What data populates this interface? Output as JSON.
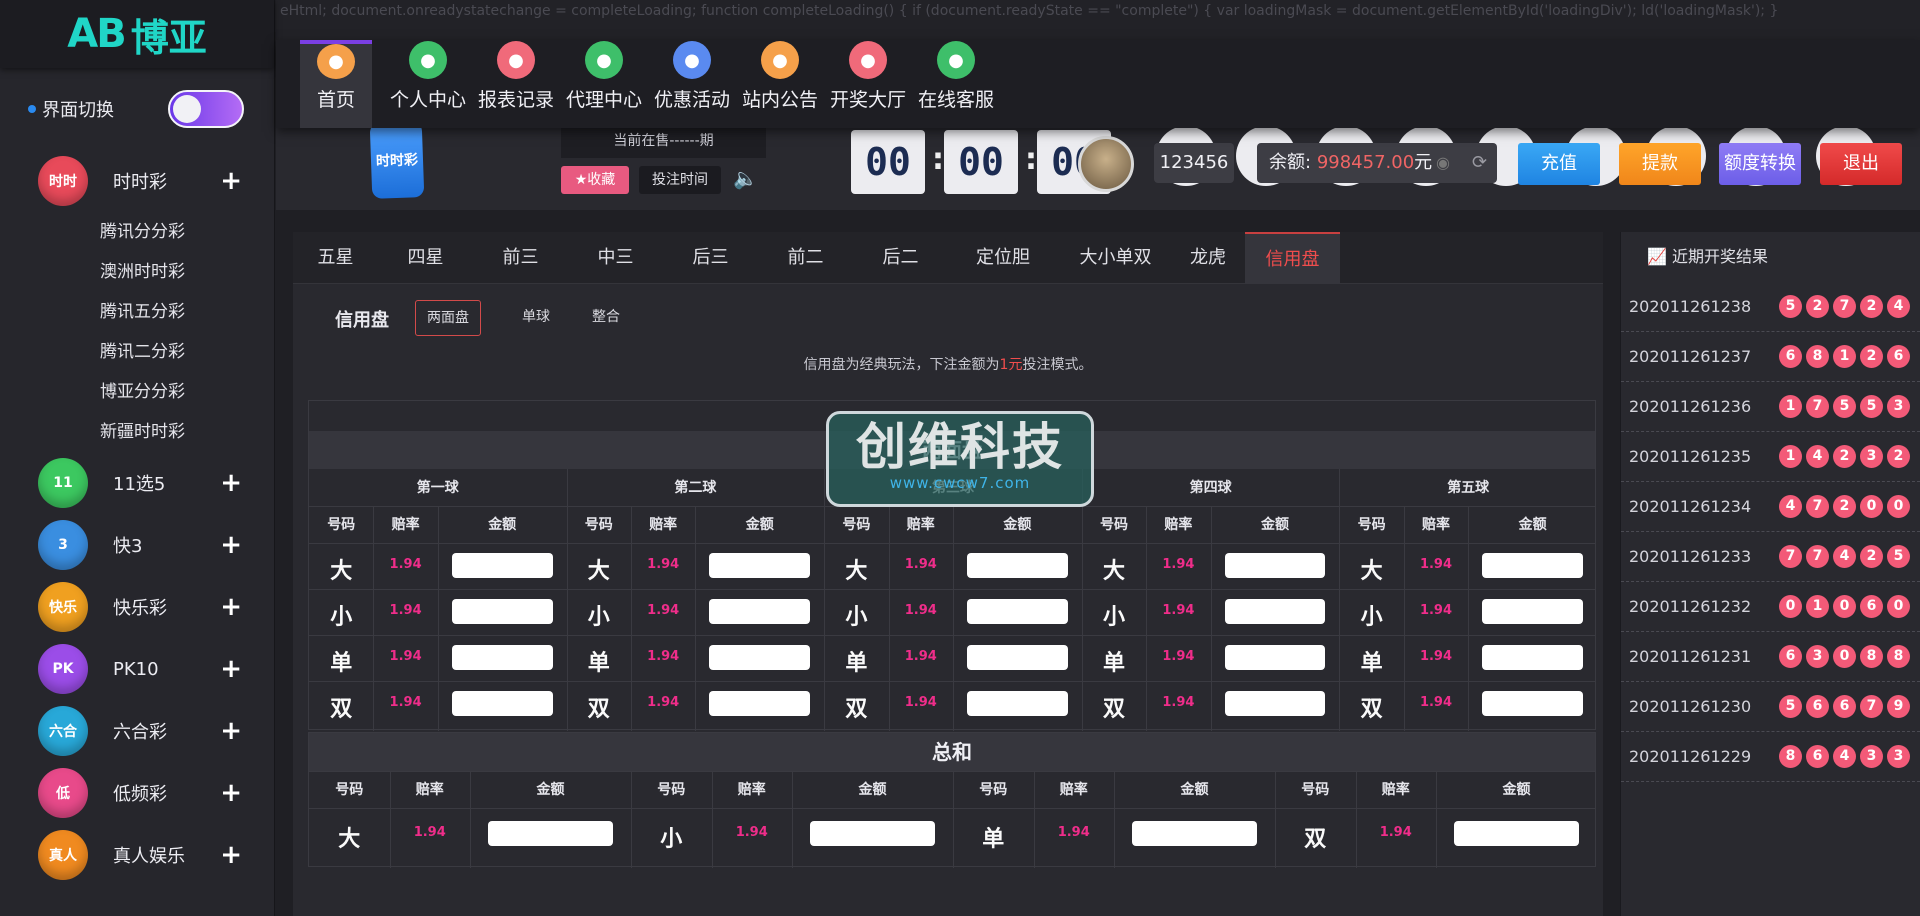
{
  "script_leak": "eHtml; document.onreadystatechange = completeLoading; function completeLoading() { if (document.readyState == \"complete\") { var loadingMask = document.getElementById('loadingDiv'); ld('loadingMask'); }",
  "logo": {
    "mark": "AB",
    "text": "博亚"
  },
  "sidebar": {
    "theme_label": "界面切换",
    "categories": [
      {
        "icon_text": "时时",
        "label": "时时彩",
        "color": "#e84a5a",
        "subs": [
          "腾讯分分彩",
          "澳洲时时彩",
          "腾讯五分彩",
          "腾讯二分彩",
          "博亚分分彩",
          "新疆时时彩"
        ]
      },
      {
        "icon_text": "11",
        "label": "11选5",
        "color": "#3cc860"
      },
      {
        "icon_text": "3",
        "label": "快3",
        "color": "#3a8ee0"
      },
      {
        "icon_text": "快乐",
        "label": "快乐彩",
        "color": "#f0a020"
      },
      {
        "icon_text": "PK",
        "label": "PK10",
        "color": "#9b4de8"
      },
      {
        "icon_text": "六合",
        "label": "六合彩",
        "color": "#28a8d8"
      },
      {
        "icon_text": "低",
        "label": "低频彩",
        "color": "#e84a8a"
      },
      {
        "icon_text": "真人",
        "label": "真人娱乐",
        "color": "#f08a20"
      }
    ],
    "plus": "+"
  },
  "nav": [
    {
      "label": "首页",
      "icon": "home-icon",
      "color": "#f5a04a"
    },
    {
      "label": "个人中心",
      "icon": "user-icon",
      "color": "#3ebf6a"
    },
    {
      "label": "报表记录",
      "icon": "report-icon",
      "color": "#f06a7a"
    },
    {
      "label": "代理中心",
      "icon": "agent-icon",
      "color": "#3ebf6a"
    },
    {
      "label": "优惠活动",
      "icon": "gift-icon",
      "color": "#5a8af0"
    },
    {
      "label": "站内公告",
      "icon": "mail-icon",
      "color": "#f5a04a"
    },
    {
      "label": "开奖大厅",
      "icon": "draw-icon",
      "color": "#f06a7a"
    },
    {
      "label": "在线客服",
      "icon": "support-icon",
      "color": "#3ebf6a"
    }
  ],
  "info": {
    "lottery_logo": "时时彩",
    "sale_text": "当前在售------期",
    "fav_label": "★收藏",
    "time_label": "投注时间",
    "countdown": [
      "00",
      "00",
      "00"
    ],
    "user_id": "123456",
    "balance_prefix": "余额:",
    "balance_value": "998457.00",
    "balance_unit": "元",
    "recharge": "充值",
    "withdraw": "提款",
    "transfer": "额度转换",
    "logout": "退出"
  },
  "tabs": [
    "五星",
    "四星",
    "前三",
    "中三",
    "后三",
    "前二",
    "后二",
    "定位胆",
    "大小单双",
    "龙虎",
    "信用盘"
  ],
  "mode": {
    "label": "信用盘",
    "options": [
      "两面盘",
      "单球",
      "整合"
    ]
  },
  "desc": {
    "before": "信用盘为经典玩法，下注金额为",
    "red": "1元",
    "after": "投注模式。"
  },
  "table1": {
    "title": "两面盘",
    "balls": [
      "第一球",
      "第二球",
      "第三球",
      "第四球",
      "第五球"
    ],
    "headers": [
      "号码",
      "赔率",
      "金额"
    ],
    "rows": [
      {
        "num": "大",
        "odds": "1.94"
      },
      {
        "num": "小",
        "odds": "1.94"
      },
      {
        "num": "单",
        "odds": "1.94"
      },
      {
        "num": "双",
        "odds": "1.94"
      }
    ]
  },
  "table2": {
    "title": "总和",
    "headers": [
      "号码",
      "赔率",
      "金额"
    ],
    "items": [
      {
        "num": "大",
        "odds": "1.94"
      },
      {
        "num": "小",
        "odds": "1.94"
      },
      {
        "num": "单",
        "odds": "1.94"
      },
      {
        "num": "双",
        "odds": "1.94"
      }
    ]
  },
  "watermark": {
    "big": "创维科技",
    "small": "www.cwcw7.com"
  },
  "results": {
    "title": "近期开奖结果",
    "rows": [
      {
        "issue": "202011261238",
        "balls": [
          "5",
          "2",
          "7",
          "2",
          "4"
        ]
      },
      {
        "issue": "202011261237",
        "balls": [
          "6",
          "8",
          "1",
          "2",
          "6"
        ]
      },
      {
        "issue": "202011261236",
        "balls": [
          "1",
          "7",
          "5",
          "5",
          "3"
        ]
      },
      {
        "issue": "202011261235",
        "balls": [
          "1",
          "4",
          "2",
          "3",
          "2"
        ]
      },
      {
        "issue": "202011261234",
        "balls": [
          "4",
          "7",
          "2",
          "0",
          "0"
        ]
      },
      {
        "issue": "202011261233",
        "balls": [
          "7",
          "7",
          "4",
          "2",
          "5"
        ]
      },
      {
        "issue": "202011261232",
        "balls": [
          "0",
          "1",
          "0",
          "6",
          "0"
        ]
      },
      {
        "issue": "202011261231",
        "balls": [
          "6",
          "3",
          "0",
          "8",
          "8"
        ]
      },
      {
        "issue": "202011261230",
        "balls": [
          "5",
          "6",
          "6",
          "7",
          "9"
        ]
      },
      {
        "issue": "202011261229",
        "balls": [
          "8",
          "6",
          "4",
          "3",
          "3"
        ]
      }
    ]
  }
}
